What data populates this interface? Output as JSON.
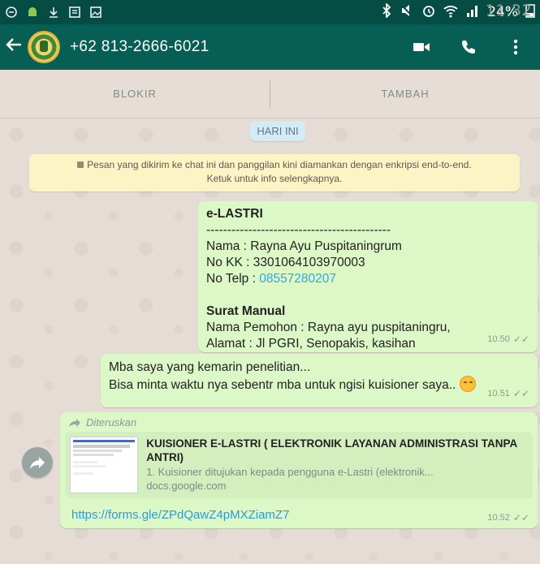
{
  "status_bar": {
    "battery": "24%",
    "time": "11:32"
  },
  "header": {
    "title": "+62 813-2666-6021"
  },
  "actions": {
    "block_label": "BLOKIR",
    "add_label": "TAMBAH"
  },
  "chat": {
    "date_label": "HARI INI",
    "encryption_notice_line1": "Pesan yang dikirim ke chat ini dan panggilan kini diamankan dengan enkripsi end-to-end.",
    "encryption_notice_line2": "Ketuk untuk info selengkapnya.",
    "messages": [
      {
        "title": "e-LASTRI",
        "divider": "--------------------------------------------",
        "name": "Nama : Rayna Ayu Puspitaningrum",
        "kk": "No KK : 3301064103970003",
        "phone_label": "No Telp : ",
        "phone": "08557280207",
        "section": "Surat Manual",
        "applicant": "Nama Pemohon : Rayna ayu puspitaningru,",
        "address": "Alamat : Jl PGRI, Senopakis, kasihan",
        "time": "10.50"
      },
      {
        "line1": "Mba saya yang kemarin penelitian...",
        "line2": "Bisa minta waktu nya sebentr mba untuk ngisi kuisioner saya..",
        "time": "10.51"
      },
      {
        "forwarded_label": "Diteruskan",
        "preview_title": "KUISIONER E-LASTRI ( ELEKTRONIK LAYANAN ADMINISTRASI TANPA ANTRI)",
        "preview_description": "1. Kuisioner ditujukan kepada pengguna e-Lastri (elektronik...",
        "preview_domain": "docs.google.com",
        "url": "https://forms.gle/ZPdQawZ4pMXZiamZ7",
        "time": "10.52"
      }
    ]
  },
  "colors": {
    "app_bar": "#075e54",
    "status_bar": "#054d44",
    "bubble_out": "#dcf8c6",
    "link": "#34a7dd",
    "chat_bg": "#e5ddd5"
  },
  "icons": [
    "bluetooth-icon",
    "mute-icon",
    "alarm-icon",
    "wifi-icon",
    "signal-icon",
    "battery-icon",
    "back-arrow-icon",
    "video-call-icon",
    "voice-call-icon",
    "more-vert-icon",
    "forward-icon",
    "lock-icon",
    "double-check-icon",
    "emoji-icon"
  ]
}
